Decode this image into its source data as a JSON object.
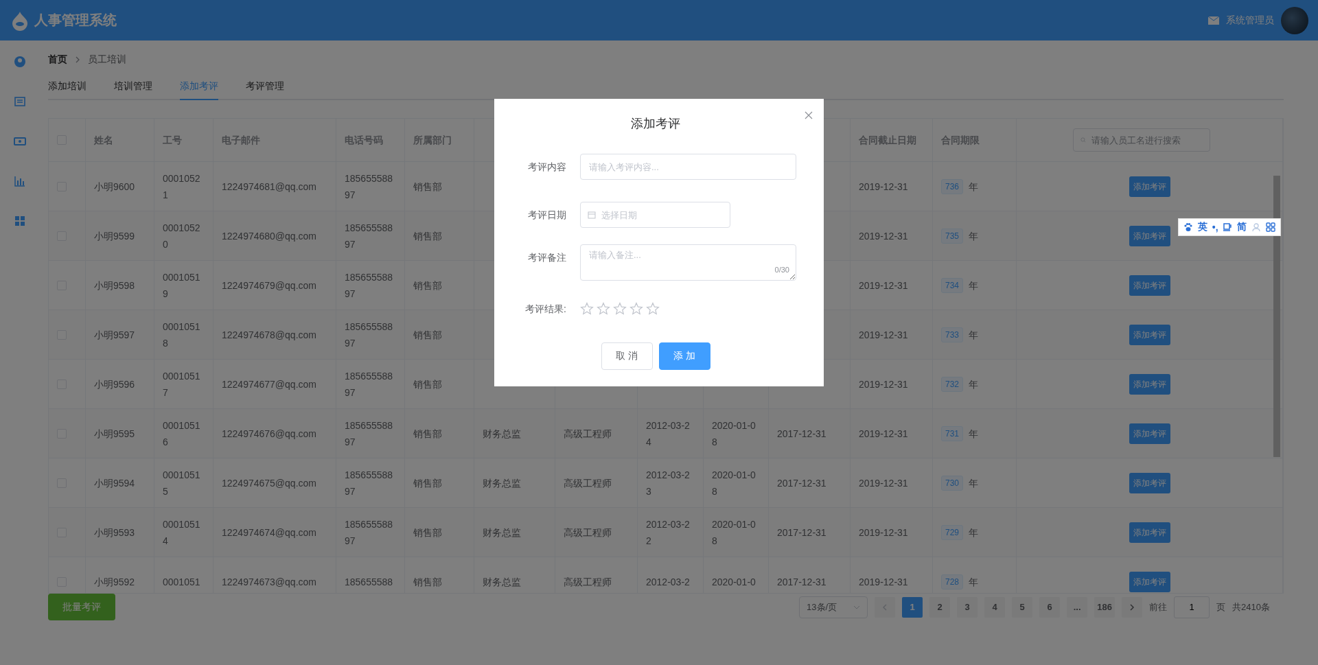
{
  "header": {
    "title": "人事管理系统",
    "user": "系统管理员"
  },
  "breadcrumb": [
    "首页",
    "员工培训"
  ],
  "tabs": [
    {
      "label": "添加培训",
      "selected": false
    },
    {
      "label": "培训管理",
      "selected": false
    },
    {
      "label": "添加考评",
      "selected": true
    },
    {
      "label": "考评管理",
      "selected": false
    }
  ],
  "table": {
    "columns": [
      "姓名",
      "工号",
      "电子邮件",
      "电话号码",
      "所属部门",
      null,
      null,
      null,
      null,
      null,
      "合同截止日期",
      "合同期限"
    ],
    "select_all": {
      "checked": false
    },
    "search": {
      "placeholder": "请输入员工名进行搜索"
    },
    "rows": [
      {
        "checked": false,
        "cells": [
          "小明9600",
          "00010521",
          "1224974681@qq.com",
          "18565558897",
          "销售部",
          null,
          null,
          null,
          null,
          null,
          "2019-12-31"
        ],
        "term": "736",
        "unit": "年",
        "action": "添加考评"
      },
      {
        "checked": false,
        "cells": [
          "小明9599",
          "00010520",
          "1224974680@qq.com",
          "18565558897",
          "销售部",
          null,
          null,
          null,
          null,
          null,
          "2019-12-31"
        ],
        "term": "735",
        "unit": "年",
        "action": "添加考评"
      },
      {
        "checked": false,
        "cells": [
          "小明9598",
          "00010519",
          "1224974679@qq.com",
          "18565558897",
          "销售部",
          null,
          null,
          null,
          null,
          null,
          "2019-12-31"
        ],
        "term": "734",
        "unit": "年",
        "action": "添加考评"
      },
      {
        "checked": false,
        "cells": [
          "小明9597",
          "00010518",
          "1224974678@qq.com",
          "18565558897",
          "销售部",
          null,
          null,
          null,
          null,
          null,
          "2019-12-31"
        ],
        "term": "733",
        "unit": "年",
        "action": "添加考评"
      },
      {
        "checked": false,
        "cells": [
          "小明9596",
          "00010517",
          "1224974677@qq.com",
          "18565558897",
          "销售部",
          null,
          null,
          null,
          null,
          null,
          "2019-12-31"
        ],
        "term": "732",
        "unit": "年",
        "action": "添加考评"
      },
      {
        "checked": false,
        "cells": [
          "小明9595",
          "00010516",
          "1224974676@qq.com",
          "18565558897",
          "销售部",
          "财务总监",
          "高级工程师",
          "2012-03-24",
          "2020-01-08",
          "2017-12-31",
          "2019-12-31"
        ],
        "term": "731",
        "unit": "年",
        "action": "添加考评"
      },
      {
        "checked": false,
        "cells": [
          "小明9594",
          "00010515",
          "1224974675@qq.com",
          "18565558897",
          "销售部",
          "财务总监",
          "高级工程师",
          "2012-03-23",
          "2020-01-08",
          "2017-12-31",
          "2019-12-31"
        ],
        "term": "730",
        "unit": "年",
        "action": "添加考评"
      },
      {
        "checked": false,
        "cells": [
          "小明9593",
          "00010514",
          "1224974674@qq.com",
          "18565558897",
          "销售部",
          "财务总监",
          "高级工程师",
          "2012-03-22",
          "2020-01-08",
          "2017-12-31",
          "2019-12-31"
        ],
        "term": "729",
        "unit": "年",
        "action": "添加考评"
      },
      {
        "checked": false,
        "cells": [
          "小明9592",
          "0001051",
          "1224974673@qq.com",
          "185655588",
          "销售部",
          "财务总监",
          "高级工程师",
          "2012-03-2",
          "2020-01-0",
          "2017-12-31",
          "2019-12-31"
        ],
        "term": "728",
        "unit": "年",
        "action": "添加考评"
      }
    ]
  },
  "pagination": {
    "batch_button": "批量考评",
    "page_size": "13条/页",
    "pages": [
      {
        "label": "1",
        "selected": true
      },
      {
        "label": "2",
        "selected": false
      },
      {
        "label": "3",
        "selected": false
      },
      {
        "label": "4",
        "selected": false
      },
      {
        "label": "5",
        "selected": false
      },
      {
        "label": "6",
        "selected": false
      },
      {
        "label": "...",
        "selected": false
      },
      {
        "label": "186",
        "selected": false
      }
    ],
    "jumper": {
      "prefix": "前往",
      "value": "1",
      "suffix": "页"
    },
    "total": "共2410条"
  },
  "modal": {
    "title": "添加考评",
    "fields": [
      {
        "kind": "input",
        "label": "考评内容",
        "placeholder": "请输入考评内容..."
      },
      {
        "kind": "date",
        "label": "考评日期",
        "placeholder": "选择日期"
      },
      {
        "kind": "textarea",
        "label": "考评备注",
        "placeholder": "请输入备注...",
        "counter": "0/30"
      },
      {
        "kind": "rate",
        "label": "考评结果:",
        "stars": 0
      }
    ],
    "buttons": [
      {
        "label": "取 消",
        "kind": "default"
      },
      {
        "label": "添 加",
        "kind": "primary"
      }
    ]
  },
  "ime_toolbar": {
    "mode": "英",
    "punctuation": "•,",
    "script": "简"
  }
}
